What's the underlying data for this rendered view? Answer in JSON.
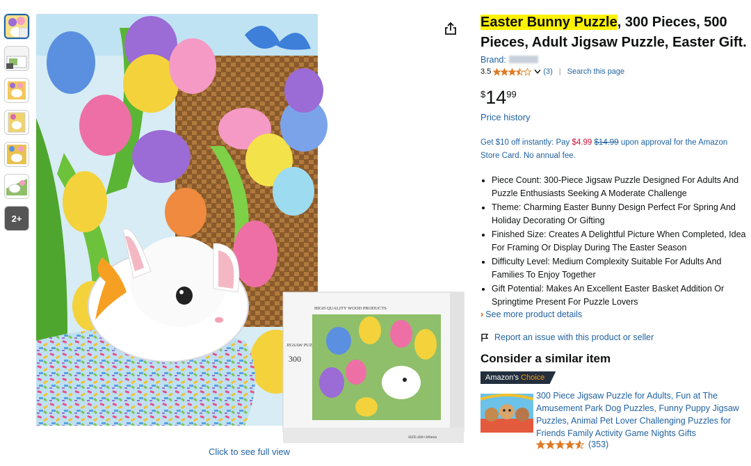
{
  "thumbnails": {
    "more_label": "2+"
  },
  "main_image": {
    "box_top_text": "HIGH QUALITY WOOD PRODUCTS",
    "box_side_text": "JIGSAW PUZZLES",
    "box_count": "300",
    "box_size": "SIZE:400×280mm"
  },
  "caption": "Click to see full view",
  "product": {
    "title_highlight": "Easter Bunny Puzzle",
    "title_line1_rest": ", 300 Pieces, 500",
    "title_line2": "Pieces, Adult Jigsaw Puzzle, Easter Gift.",
    "brand_label": "Brand:",
    "rating_value": "3.5",
    "rating_count": "(3)",
    "search_page": "Search this page",
    "price_symbol": "$",
    "price_whole": "14",
    "price_fraction": "99",
    "price_history": "Price history",
    "promo": {
      "part1": "Get $10 off instantly: Pay ",
      "pay": "$4.99",
      "strike": "$14.99",
      "part2": " upon approval for the Amazon",
      "line2": "Store Card. No annual fee."
    },
    "bullets": [
      {
        "line1": "Piece Count: 300-Piece Jigsaw Puzzle Designed For Adults And",
        "line2": "Puzzle Enthusiasts Seeking A Moderate Challenge"
      },
      {
        "line1": "Theme: Charming Easter Bunny Design Perfect For Spring And",
        "line2": "Holiday Decorating Or Gifting"
      },
      {
        "line1": "Finished Size: Creates A Delightful Picture When Completed, Idea",
        "line2": "For Framing Or Display During The Easter Season"
      },
      {
        "line1": "Difficulty Level: Medium Complexity Suitable For Adults And",
        "line2": "Families To Enjoy Together"
      },
      {
        "line1": "Gift Potential: Makes An Excellent Easter Basket Addition Or",
        "line2": "Springtime Present For Puzzle Lovers"
      }
    ],
    "see_more": "See more product details",
    "report": "Report an issue with this product or seller"
  },
  "similar": {
    "heading": "Consider a similar item",
    "badge_prefix": "Amazon's",
    "badge_suffix": "Choice",
    "lines": [
      "300 Piece Jigsaw Puzzle for Adults, Fun at The",
      "Amusement Park Dog Puzzles, Funny Puppy Jigsaw",
      "Puzzles, Animal Pet Lover Challenging Puzzles for",
      "Friends Family Activity Game Nights Gifts"
    ],
    "rating_count": "(353)"
  },
  "colors": {
    "link": "#2162a1",
    "price_red": "#cc0c39",
    "highlight": "#fff200",
    "star": "#de7921",
    "choice_bg": "#232f3e",
    "choice_accent": "#ff9900"
  }
}
